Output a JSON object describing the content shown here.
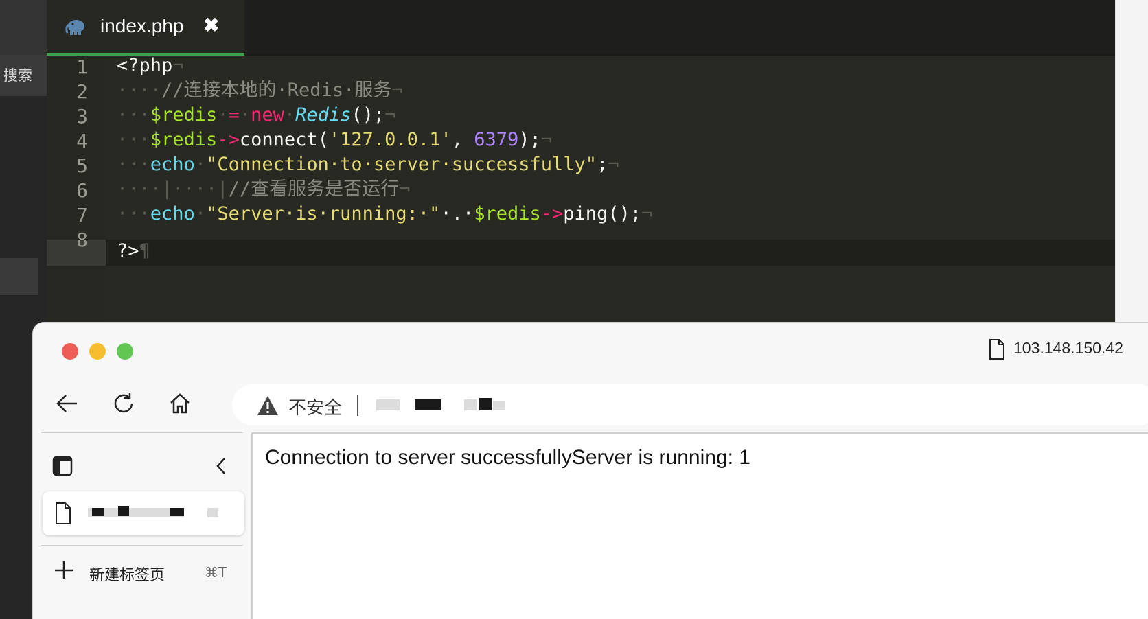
{
  "editor": {
    "search_tab": "搜索",
    "tab_title": "index.php",
    "tab_close": "✖",
    "line_numbers": [
      "1",
      "2",
      "3",
      "4",
      "5",
      "6",
      "7",
      "8"
    ],
    "lines": {
      "l1": {
        "code": "<?php",
        "eol": "¬"
      },
      "l2": {
        "ws": "····",
        "comment": "//连接本地的·Redis·服务",
        "eol": "¬"
      },
      "l3": {
        "ws": "···",
        "var": "$redis",
        "sp1": "·",
        "op": "=",
        "sp2": "·",
        "kw": "new",
        "sp3": "·",
        "cls": "Redis",
        "rest": "();",
        "eol": "¬"
      },
      "l4": {
        "ws": "···",
        "var": "$redis",
        "arrow": "->",
        "fn": "connect(",
        "str": "'127.0.0.1'",
        "comma": ", ",
        "num": "6379",
        "rest": ");",
        "eol": "¬"
      },
      "l5": {
        "ws": "···",
        "bi": "echo",
        "sp": "·",
        "str": "\"Connection·to·server·successfully\"",
        "rest": ";",
        "eol": "¬"
      },
      "l6": {
        "ws": "····|····|",
        "comment": "//查看服务是否运行",
        "eol": "¬"
      },
      "l7": {
        "ws": "···",
        "bi": "echo",
        "sp": "·",
        "str": "\"Server·is·running:·\"",
        "dot": "·.·",
        "var": "$redis",
        "arrow": "->",
        "rest": "ping();",
        "eol": "¬"
      },
      "l8": {
        "code": "?>",
        "eol": "¶"
      }
    }
  },
  "browser": {
    "window_title_url": "103.148.150.42",
    "address": {
      "security_label": "不安全"
    },
    "sidebar": {
      "new_tab_label": "新建标签页",
      "new_tab_shortcut": "⌘T"
    },
    "page_content": "Connection to server successfullyServer is running: 1"
  }
}
